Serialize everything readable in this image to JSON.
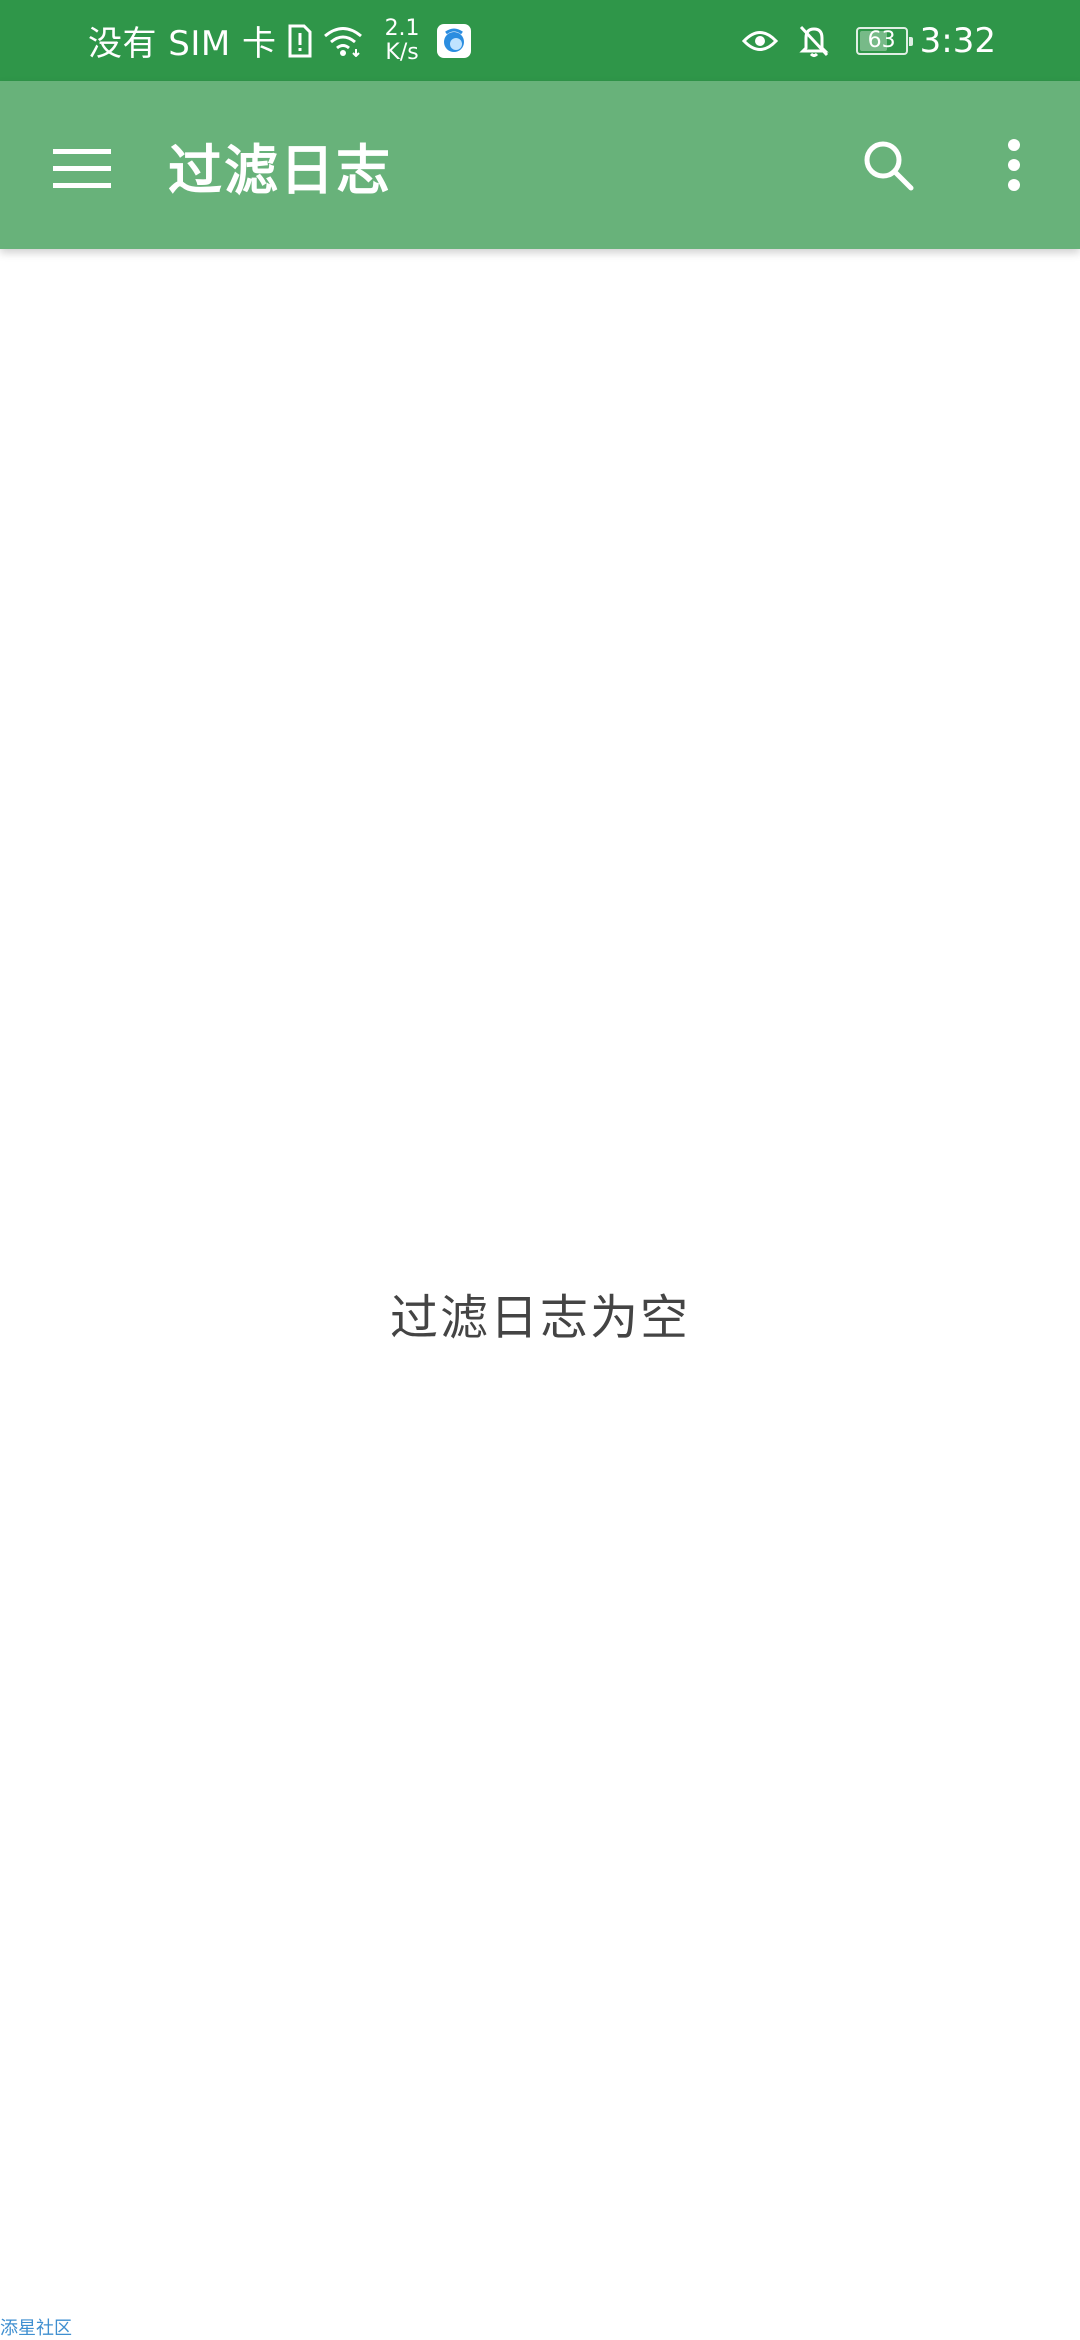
{
  "status_bar": {
    "carrier": "没有 SIM 卡",
    "net_speed_value": "2.1",
    "net_speed_unit": "K/s",
    "battery_level": "63",
    "battery_fraction": 0.63,
    "time": "3:32"
  },
  "app_bar": {
    "title": "过滤日志",
    "menu_icon": "hamburger-menu-icon",
    "search_icon": "search-icon",
    "overflow_icon": "more-vert-icon"
  },
  "main": {
    "empty_message": "过滤日志为空"
  },
  "watermark": "添星社区",
  "colors": {
    "status_bar": "#2f9649",
    "app_bar": "#68b27a",
    "background": "#ffffff",
    "empty_text": "#444444"
  }
}
